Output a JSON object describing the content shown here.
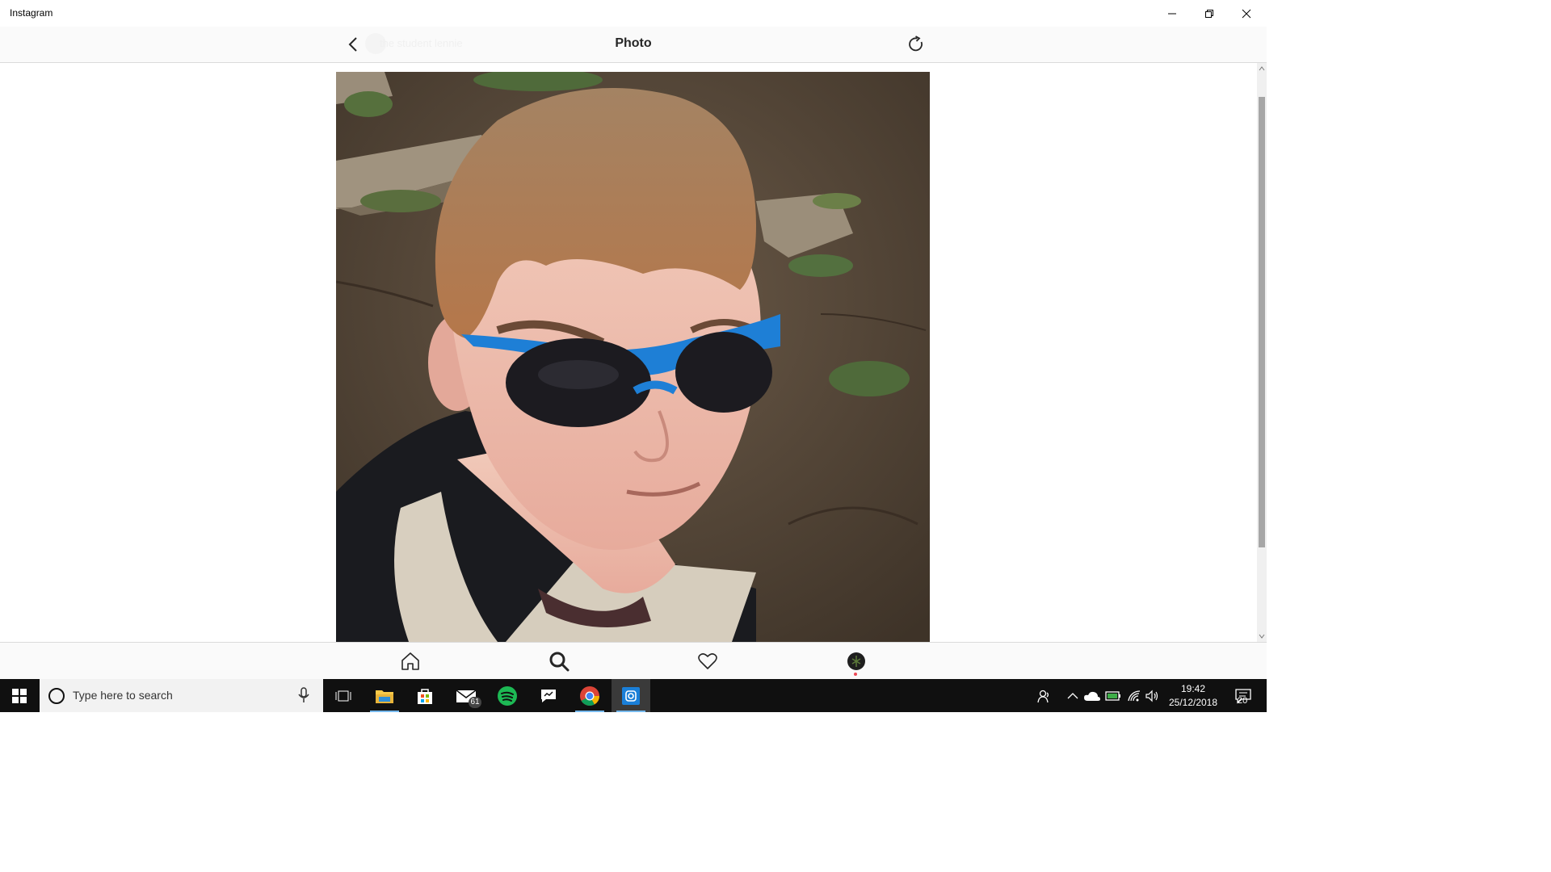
{
  "window": {
    "title": "Instagram"
  },
  "header": {
    "title": "Photo",
    "faded_username": "the student lennie"
  },
  "photo": {
    "description_icon": "selfie-photo"
  },
  "bottom_nav": {
    "items": [
      "home-icon",
      "search-icon",
      "heart-icon",
      "profile-avatar"
    ],
    "active_dot_color": "#ed4956"
  },
  "taskbar": {
    "search_placeholder": "Type here to search",
    "mail_badge": "61",
    "time": "19:42",
    "date": "25/12/2018",
    "notifications_count": "20",
    "accent": "#76b9ed"
  }
}
